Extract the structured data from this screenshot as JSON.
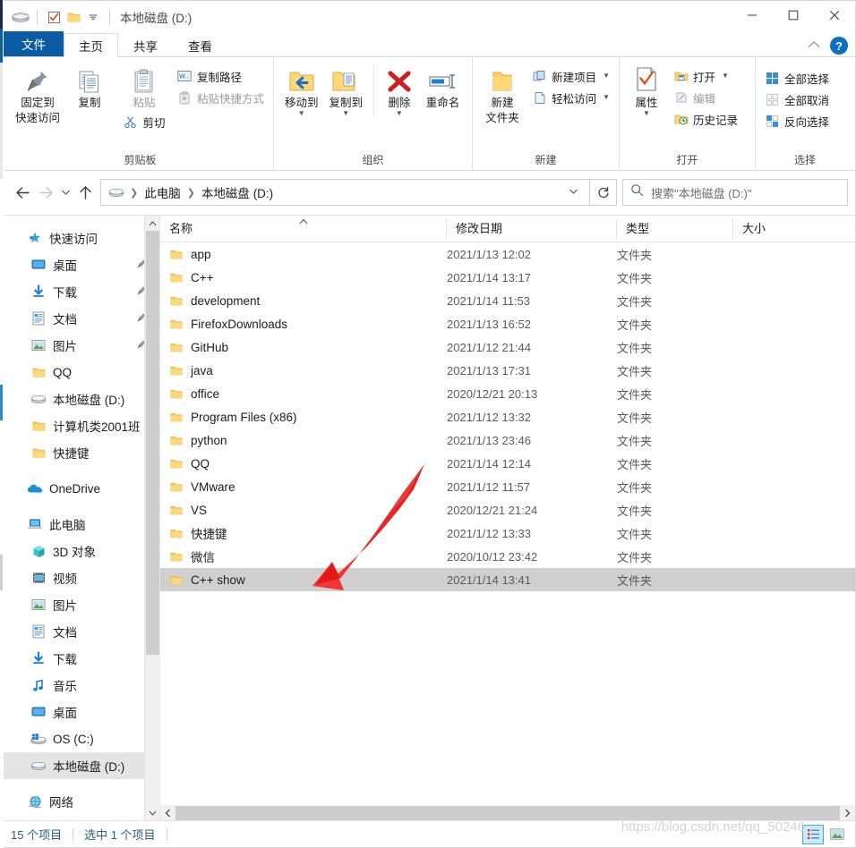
{
  "window": {
    "title": "本地磁盘 (D:)",
    "quick_access_icons": [
      "drive-icon",
      "properties-checkbox-icon",
      "new-folder-icon",
      "customize-chevron-icon"
    ],
    "controls": {
      "minimize": "—",
      "maximize": "▢",
      "close": "✕"
    }
  },
  "tabs": [
    {
      "label": "文件",
      "kind": "file"
    },
    {
      "label": "主页",
      "kind": "active"
    },
    {
      "label": "共享",
      "kind": "normal"
    },
    {
      "label": "查看",
      "kind": "normal"
    }
  ],
  "ribbon": {
    "collapse_icon": "chevron-up-icon",
    "help_label": "?",
    "groups": [
      {
        "name": "clipboard",
        "label": "剪贴板",
        "big": [
          {
            "label_line1": "固定到",
            "label_line2": "快速访问",
            "icon": "pin-icon"
          },
          {
            "label_line1": "复制",
            "label_line2": "",
            "icon": "copy-icon"
          }
        ],
        "paste": {
          "label": "粘贴",
          "icon": "paste-icon",
          "dim": true
        },
        "cut": {
          "label": "剪切",
          "icon": "scissors-icon"
        },
        "small": [
          {
            "label": "复制路径",
            "icon": "copy-path-icon",
            "dim": false
          },
          {
            "label": "粘贴快捷方式",
            "icon": "paste-shortcut-icon",
            "dim": true
          }
        ]
      },
      {
        "name": "organize",
        "label": "组织",
        "items": [
          {
            "label": "移动到",
            "icon": "move-to-icon",
            "caret": true
          },
          {
            "label": "复制到",
            "icon": "copy-to-icon",
            "caret": true
          },
          {
            "label": "删除",
            "icon": "delete-x-icon",
            "caret": true
          },
          {
            "label": "重命名",
            "icon": "rename-icon",
            "caret": false
          }
        ]
      },
      {
        "name": "new",
        "label": "新建",
        "big": {
          "label_line1": "新建",
          "label_line2": "文件夹",
          "icon": "new-folder-icon"
        },
        "small": [
          {
            "label": "新建项目",
            "icon": "new-item-icon",
            "caret": true
          },
          {
            "label": "轻松访问",
            "icon": "easy-access-icon",
            "caret": true
          }
        ]
      },
      {
        "name": "open",
        "label": "打开",
        "big": {
          "label": "属性",
          "icon": "properties-icon",
          "caret": true
        },
        "small": [
          {
            "label": "打开",
            "icon": "open-folder-icon",
            "caret": true,
            "dim": false
          },
          {
            "label": "编辑",
            "icon": "edit-icon",
            "caret": false,
            "dim": true
          },
          {
            "label": "历史记录",
            "icon": "history-icon",
            "caret": false,
            "dim": false
          }
        ]
      },
      {
        "name": "select",
        "label": "选择",
        "small": [
          {
            "label": "全部选择",
            "icon": "select-all-icon"
          },
          {
            "label": "全部取消",
            "icon": "select-none-icon"
          },
          {
            "label": "反向选择",
            "icon": "invert-selection-icon"
          }
        ]
      }
    ]
  },
  "addressbar": {
    "back_icon": "arrow-left-icon",
    "forward_icon": "arrow-right-icon",
    "recent_icon": "chevron-down-icon",
    "up_icon": "arrow-up-icon",
    "drive_icon": "drive-icon",
    "crumbs": [
      "此电脑",
      "本地磁盘 (D:)"
    ],
    "dropdown_icon": "chevron-down-icon",
    "refresh_icon": "refresh-icon"
  },
  "search": {
    "icon": "search-icon",
    "placeholder": "搜索\"本地磁盘 (D:)\""
  },
  "navpane": {
    "items": [
      {
        "label": "快速访问",
        "icon": "star-quick-access-icon",
        "indent": 0,
        "pin": false,
        "selected": false
      },
      {
        "label": "桌面",
        "icon": "desktop-icon",
        "indent": 1,
        "pin": true,
        "selected": false
      },
      {
        "label": "下载",
        "icon": "downloads-icon",
        "indent": 1,
        "pin": true,
        "selected": false
      },
      {
        "label": "文档",
        "icon": "documents-icon",
        "indent": 1,
        "pin": true,
        "selected": false
      },
      {
        "label": "图片",
        "icon": "pictures-icon",
        "indent": 1,
        "pin": true,
        "selected": false
      },
      {
        "label": "QQ",
        "icon": "folder-icon",
        "indent": 1,
        "pin": false,
        "selected": false
      },
      {
        "label": "本地磁盘 (D:)",
        "icon": "drive-icon",
        "indent": 1,
        "pin": false,
        "selected": false
      },
      {
        "label": "计算机类2001班",
        "icon": "folder-icon",
        "indent": 1,
        "pin": false,
        "selected": false
      },
      {
        "label": "快捷键",
        "icon": "folder-icon",
        "indent": 1,
        "pin": false,
        "selected": false
      },
      {
        "label": "OneDrive",
        "icon": "onedrive-cloud-icon",
        "indent": 0,
        "pin": false,
        "selected": false,
        "gap_before": true
      },
      {
        "label": "此电脑",
        "icon": "this-pc-icon",
        "indent": 0,
        "pin": false,
        "selected": false,
        "gap_before": true
      },
      {
        "label": "3D 对象",
        "icon": "3d-objects-icon",
        "indent": 1,
        "pin": false,
        "selected": false
      },
      {
        "label": "视频",
        "icon": "videos-icon",
        "indent": 1,
        "pin": false,
        "selected": false
      },
      {
        "label": "图片",
        "icon": "pictures-icon",
        "indent": 1,
        "pin": false,
        "selected": false
      },
      {
        "label": "文档",
        "icon": "documents-icon",
        "indent": 1,
        "pin": false,
        "selected": false
      },
      {
        "label": "下载",
        "icon": "downloads-icon",
        "indent": 1,
        "pin": false,
        "selected": false
      },
      {
        "label": "音乐",
        "icon": "music-icon",
        "indent": 1,
        "pin": false,
        "selected": false
      },
      {
        "label": "桌面",
        "icon": "desktop-icon",
        "indent": 1,
        "pin": false,
        "selected": false
      },
      {
        "label": "OS (C:)",
        "icon": "windows-drive-icon",
        "indent": 1,
        "pin": false,
        "selected": false
      },
      {
        "label": "本地磁盘 (D:)",
        "icon": "drive-icon",
        "indent": 1,
        "pin": false,
        "selected": true
      },
      {
        "label": "网络",
        "icon": "network-icon",
        "indent": 0,
        "pin": false,
        "selected": false,
        "gap_before": true
      }
    ],
    "scroll_up_icon": "chevron-up-icon",
    "scroll_down_icon": "chevron-down-icon"
  },
  "filelist": {
    "columns": [
      {
        "key": "name",
        "label": "名称",
        "sorted": "asc"
      },
      {
        "key": "date",
        "label": "修改日期",
        "sorted": null
      },
      {
        "key": "type",
        "label": "类型",
        "sorted": null
      },
      {
        "key": "size",
        "label": "大小",
        "sorted": null
      }
    ],
    "rows": [
      {
        "name": "app",
        "date": "2021/1/13 12:02",
        "type": "文件夹",
        "size": "",
        "icon": "folder-icon",
        "selected": false
      },
      {
        "name": "C++",
        "date": "2021/1/14 13:17",
        "type": "文件夹",
        "size": "",
        "icon": "folder-icon",
        "selected": false
      },
      {
        "name": "development",
        "date": "2021/1/14 11:53",
        "type": "文件夹",
        "size": "",
        "icon": "folder-icon",
        "selected": false
      },
      {
        "name": "FirefoxDownloads",
        "date": "2021/1/13 16:52",
        "type": "文件夹",
        "size": "",
        "icon": "folder-icon",
        "selected": false
      },
      {
        "name": "GitHub",
        "date": "2021/1/12 21:44",
        "type": "文件夹",
        "size": "",
        "icon": "folder-icon",
        "selected": false
      },
      {
        "name": "java",
        "date": "2021/1/13 17:31",
        "type": "文件夹",
        "size": "",
        "icon": "folder-icon",
        "selected": false
      },
      {
        "name": "office",
        "date": "2020/12/21 20:13",
        "type": "文件夹",
        "size": "",
        "icon": "folder-icon",
        "selected": false
      },
      {
        "name": "Program Files (x86)",
        "date": "2021/1/12 13:32",
        "type": "文件夹",
        "size": "",
        "icon": "folder-icon",
        "selected": false
      },
      {
        "name": "python",
        "date": "2021/1/13 23:46",
        "type": "文件夹",
        "size": "",
        "icon": "folder-icon",
        "selected": false
      },
      {
        "name": "QQ",
        "date": "2021/1/14 12:14",
        "type": "文件夹",
        "size": "",
        "icon": "folder-icon",
        "selected": false
      },
      {
        "name": "VMware",
        "date": "2021/1/12 11:57",
        "type": "文件夹",
        "size": "",
        "icon": "folder-icon",
        "selected": false
      },
      {
        "name": "VS",
        "date": "2020/12/21 21:24",
        "type": "文件夹",
        "size": "",
        "icon": "folder-icon",
        "selected": false
      },
      {
        "name": "快捷键",
        "date": "2021/1/12 13:33",
        "type": "文件夹",
        "size": "",
        "icon": "folder-icon",
        "selected": false
      },
      {
        "name": "微信",
        "date": "2020/10/12 23:42",
        "type": "文件夹",
        "size": "",
        "icon": "folder-icon",
        "selected": false
      },
      {
        "name": "C++ show",
        "date": "2021/1/14 13:41",
        "type": "文件夹",
        "size": "",
        "icon": "folder-icon",
        "selected": true
      }
    ],
    "hscroll_left_icon": "chevron-left-icon",
    "hscroll_right_icon": "chevron-right-icon"
  },
  "statusbar": {
    "item_count": "15 个项目",
    "selection": "选中 1 个项目",
    "views": [
      {
        "name": "details-view-button",
        "active": true
      },
      {
        "name": "large-icons-view-button",
        "active": false
      }
    ]
  },
  "watermark": "https://blog.csdn.net/qq_50246",
  "annotation": {
    "type": "red-arrow",
    "color": "#ee2222"
  },
  "colors": {
    "accent": "#0b5ca5",
    "selection": "#cfcfcf",
    "folder": "#ffce5c",
    "status_text": "#2b5c8a"
  }
}
